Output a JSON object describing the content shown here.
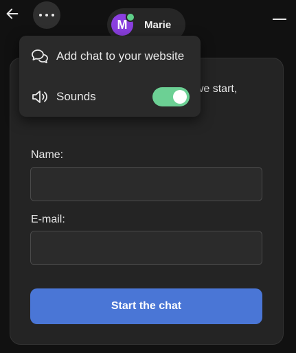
{
  "header": {
    "agent_initial": "M",
    "agent_name": "Marie"
  },
  "menu": {
    "add_chat_label": "Add chat to your website",
    "sounds_label": "Sounds",
    "sounds_enabled": true
  },
  "form": {
    "intro_text": "Welcome to our LiveChat! Before we start, please fill in the fields below",
    "name_label": "Name:",
    "name_value": "",
    "email_label": "E-mail:",
    "email_value": "",
    "submit_label": "Start the chat"
  },
  "colors": {
    "accent": "#4a76d6",
    "toggle_on": "#6cd094",
    "avatar_bg": "#8b3fe0",
    "online": "#5fcf8a"
  },
  "icons": {
    "back": "arrow-left-icon",
    "more": "more-horizontal-icon",
    "minimize": "minimize-icon",
    "chat": "chat-bubbles-icon",
    "sound": "speaker-icon",
    "emoji": "pointing-down-emoji"
  }
}
